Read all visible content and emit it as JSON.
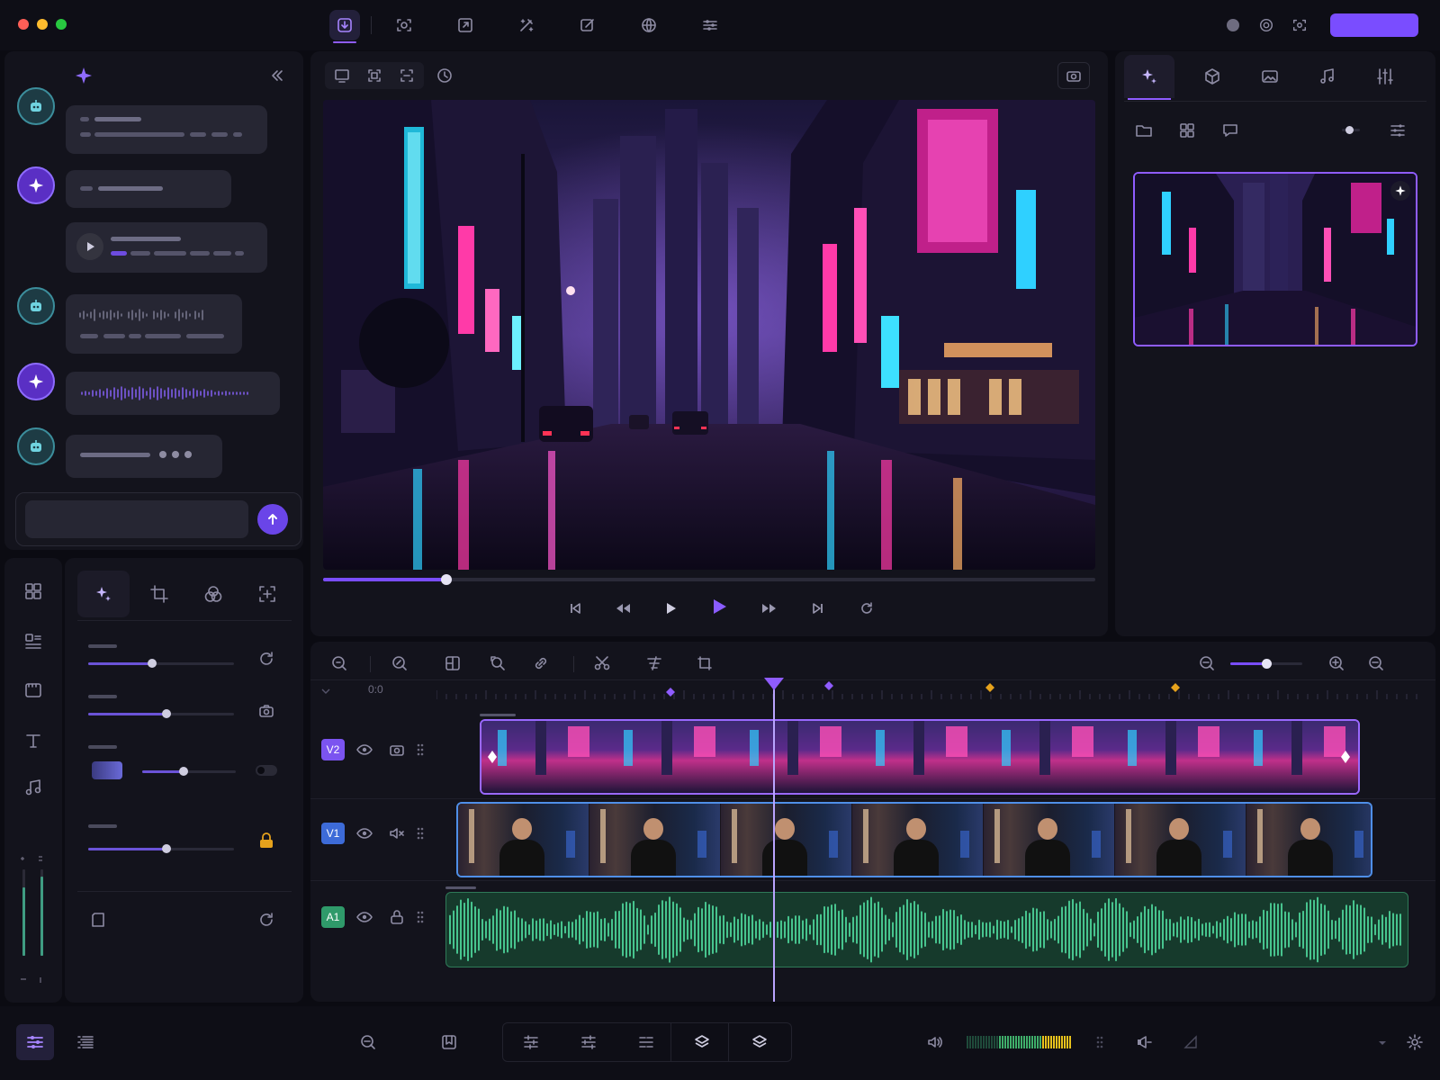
{
  "window": {
    "title": ""
  },
  "toolbar": {
    "tools": [
      "import-icon",
      "scan-icon",
      "export-icon",
      "magic-edit-icon",
      "edit-icon",
      "globe-icon",
      "adjust-icon"
    ],
    "active_index": 0
  },
  "chat": {
    "messages": [
      {
        "role": "bot",
        "type": "text"
      },
      {
        "role": "ai",
        "type": "text"
      },
      {
        "role": "ai",
        "type": "audio-clip"
      },
      {
        "role": "bot",
        "type": "waveform"
      },
      {
        "role": "ai",
        "type": "waveform"
      },
      {
        "role": "bot",
        "type": "typing"
      }
    ],
    "input_placeholder": ""
  },
  "inspector": {
    "tabs": [
      "magic-icon",
      "crop-icon",
      "color-blend-icon",
      "transform-icon"
    ],
    "active_tab": 0,
    "sliders": [
      {
        "value": 0.44
      },
      {
        "value": 0.54
      },
      {
        "value": 0.44
      },
      {
        "value": 0.54
      }
    ],
    "toggle_on": false
  },
  "player": {
    "progress": 0.16,
    "controls": [
      "skip-back",
      "rewind",
      "play",
      "play-active",
      "fast-forward",
      "skip-forward",
      "loop"
    ]
  },
  "media": {
    "tabs": [
      "ai-magic-icon",
      "3d-box-icon",
      "image-icon",
      "music-icon",
      "mixer-icon"
    ],
    "active_tab": 0
  },
  "timeline": {
    "timecode": "0:0",
    "zoom": 0.5,
    "playhead": 0.34,
    "tracks": [
      {
        "id": "V2",
        "color": "#7b54f0",
        "kind": "video-overlay"
      },
      {
        "id": "V1",
        "color": "#3d6bd8",
        "kind": "video"
      },
      {
        "id": "A1",
        "color": "#2f9a6a",
        "kind": "audio"
      }
    ]
  },
  "colors": {
    "accent": "#7a4dff",
    "v2": "#9a68ff",
    "v1": "#4f8fe8",
    "audio": "#3fb885",
    "keyframe_purple": "#8f5cff",
    "keyframe_orange": "#e6a21c"
  }
}
